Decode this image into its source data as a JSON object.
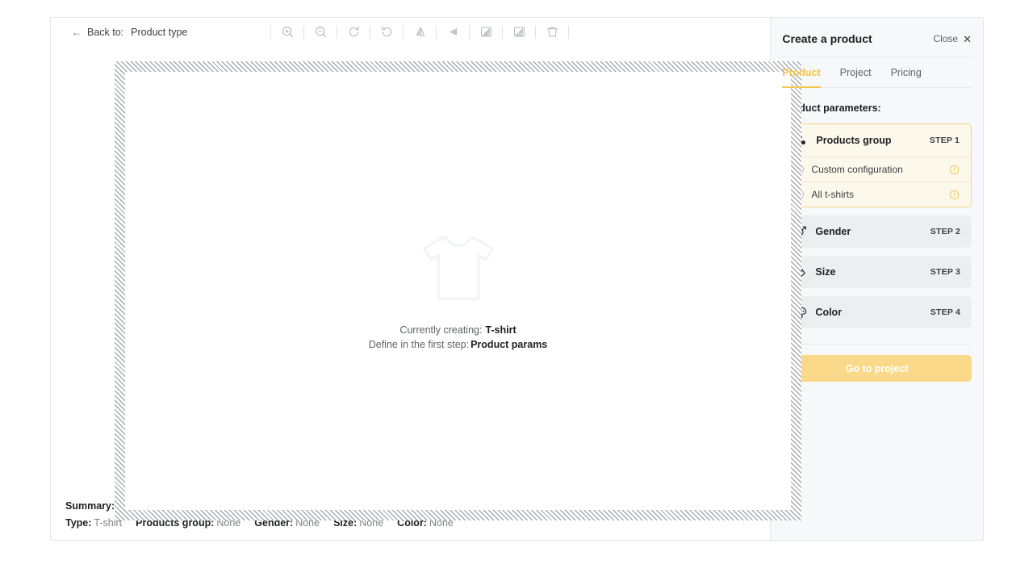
{
  "editor": {
    "back": {
      "arrow": "back-arrow-icon",
      "label": "← Back to:",
      "prefix": "Back to:",
      "target": "Product type"
    },
    "toolbar_tools": [
      {
        "name": "zoom-in-icon",
        "title": "Zoom in"
      },
      {
        "name": "zoom-out-icon",
        "title": "Zoom out"
      },
      {
        "name": "rotate-clockwise-icon",
        "title": "Rotate right"
      },
      {
        "name": "rotate-counterclockwise-icon",
        "title": "Rotate left"
      },
      {
        "name": "flip-horizontal-icon",
        "title": "Flip horizontal"
      },
      {
        "name": "flip-vertical-icon",
        "title": "Flip vertical"
      },
      {
        "name": "shadow-s-icon",
        "title": "S"
      },
      {
        "name": "shadow-sw-icon",
        "title": "SW"
      },
      {
        "name": "delete-icon",
        "title": "Delete"
      }
    ],
    "canvas": {
      "ghost_icon": "tshirt-outline-icon",
      "line1_label": "Currently creating:",
      "line1_value": "T-shirt",
      "line2_label": "Define in the first step:",
      "line2_value": "Product params"
    },
    "summary": {
      "title": "Summary:",
      "items": [
        {
          "key": "Type:",
          "value": "T-shirt"
        },
        {
          "key": "Products group:",
          "value": "None"
        },
        {
          "key": "Gender:",
          "value": "None"
        },
        {
          "key": "Size:",
          "value": "None"
        },
        {
          "key": "Color:",
          "value": "None"
        }
      ]
    }
  },
  "panel": {
    "title": "Create a product",
    "close_label": "Close",
    "close_glyph": "✕",
    "tabs": [
      {
        "label": "Product",
        "active": true
      },
      {
        "label": "Project",
        "active": false
      },
      {
        "label": "Pricing",
        "active": false
      }
    ],
    "params_label": "Product parameters:",
    "steps": [
      {
        "name": "Products group",
        "badge": "STEP 1",
        "icon": "three-dots-icon",
        "active": true,
        "options": [
          {
            "label": "Custom configuration",
            "selected": false,
            "info": "info-icon"
          },
          {
            "label": "All t-shirts",
            "selected": false,
            "info": "info-icon"
          }
        ]
      },
      {
        "name": "Gender",
        "badge": "STEP 2",
        "icon": "gender-icon",
        "active": false,
        "options": []
      },
      {
        "name": "Size",
        "badge": "STEP 3",
        "icon": "ruler-icon",
        "active": false,
        "options": []
      },
      {
        "name": "Color",
        "badge": "STEP 4",
        "icon": "palette-icon",
        "active": false,
        "options": []
      }
    ],
    "cta_label": "Go to project"
  },
  "colors": {
    "accent": "#f5c552",
    "cta_bg": "#fada8a",
    "panel_bg": "#f7f8f9",
    "card_bg": "#eceef0",
    "active_card_bg": "#fdf8ec",
    "text": "#202124",
    "muted": "#5f6368"
  }
}
